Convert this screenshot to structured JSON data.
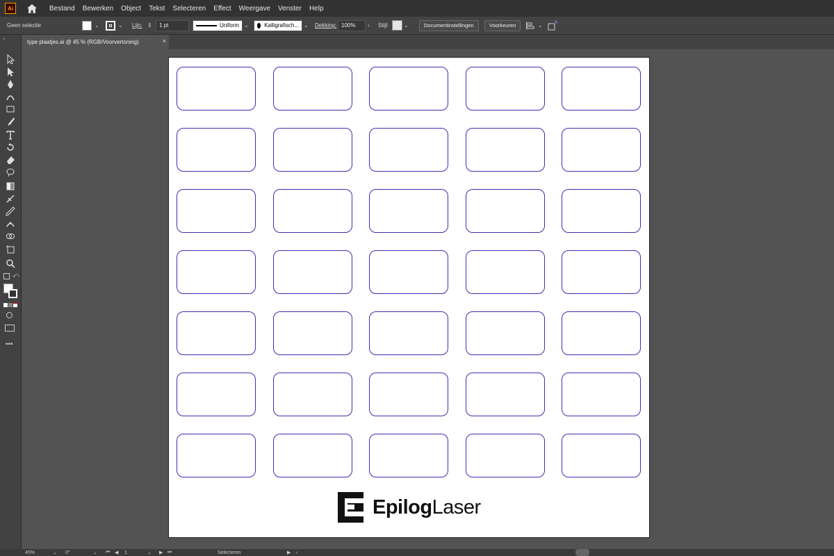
{
  "app": {
    "logo_text": "Ai"
  },
  "menu": [
    "Bestand",
    "Bewerken",
    "Object",
    "Tekst",
    "Selecteren",
    "Effect",
    "Weergave",
    "Venster",
    "Help"
  ],
  "control_bar": {
    "selection_label": "Geen selectie",
    "stroke_label": "Lijn:",
    "stroke_weight": "1 pt",
    "stroke_profile": "Uniform",
    "brush": "Kalligrafisch...",
    "opacity_label": "Dekking:",
    "opacity": "100%",
    "style_label": "Stijl:",
    "doc_settings_btn": "Documentinstellingen",
    "preferences_btn": "Voorkeuren"
  },
  "document_tab": {
    "title": "type plaatjes.ai @ 45 % (RGB/Voorvertoning)",
    "close": "×"
  },
  "artboard": {
    "plate_rows": 7,
    "plate_cols": 5,
    "plate_stroke_color": "#3a2fb0",
    "logo": {
      "bold": "Epilog",
      "regular": "Laser"
    }
  },
  "status_bar": {
    "zoom": "45%",
    "rotation": "0°",
    "artboard_number": "1",
    "status_text": "Selecteren"
  },
  "tools": [
    "selection-tool-icon",
    "direct-selection-tool-icon",
    "pen-tool-icon",
    "curvature-tool-icon",
    "rectangle-tool-icon",
    "paintbrush-tool-icon",
    "type-tool-icon",
    "rotate-tool-icon",
    "eraser-tool-icon",
    "lasso-tool-icon",
    "gradient-tool-icon",
    "mesh-tool-icon",
    "eyedropper-tool-icon",
    "puppet-warp-tool-icon",
    "shape-builder-tool-icon",
    "artboard-tool-icon",
    "zoom-tool-icon"
  ]
}
